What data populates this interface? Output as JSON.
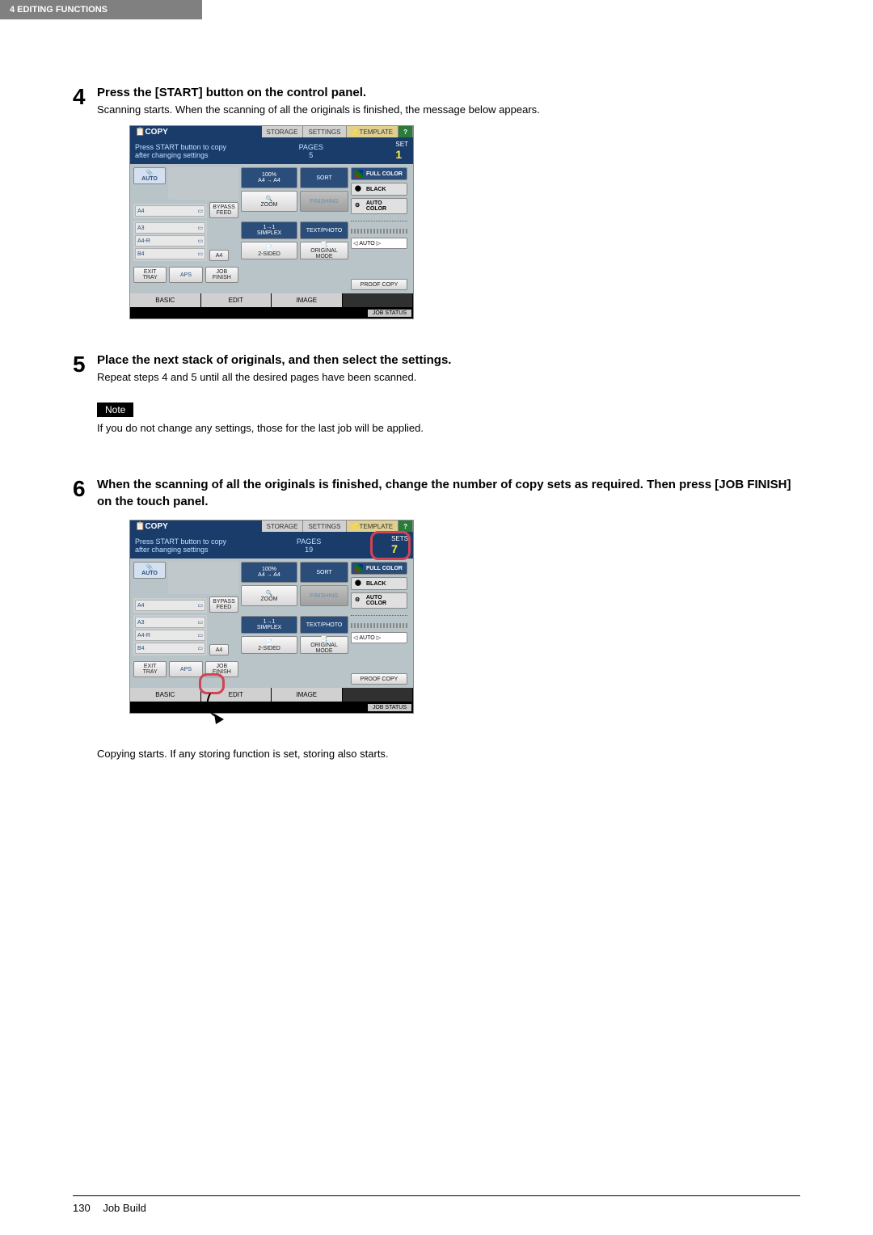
{
  "header": {
    "section": "4 EDITING FUNCTIONS"
  },
  "steps": [
    {
      "num": "4",
      "head": "Press the [START] button on the control panel.",
      "text": "Scanning starts. When the scanning of all the originals is finished, the message below appears."
    },
    {
      "num": "5",
      "head": "Place the next stack of originals, and then select the settings.",
      "text": "Repeat steps 4 and 5 until all the desired pages have been scanned.",
      "note_label": "Note",
      "note_text": "If you do not change any settings, those for the last job will be applied."
    },
    {
      "num": "6",
      "head": "When the scanning of all the originals is finished, change the number of copy sets as required. Then press [JOB FINISH] on the touch panel.",
      "after_text": "Copying starts. If any storing function is set, storing also starts."
    }
  ],
  "panel": {
    "copy": "COPY",
    "storage": "STORAGE",
    "settings": "SETTINGS",
    "template": "TEMPLATE",
    "help": "?",
    "msg_line1": "Press START button to copy",
    "msg_line2": "after changing settings",
    "pages_label": "PAGES",
    "set_label": "SET",
    "auto": "AUTO",
    "bypass": "BYPASS FEED",
    "a4": "A4",
    "a3": "A3",
    "a4r": "A4-R",
    "b4": "B4",
    "a4_small": "A4",
    "exit": "EXIT TRAY",
    "aps": "APS",
    "jobfinish": "JOB FINISH",
    "zoom_pct": "100%",
    "zoom_paper": "A4 → A4",
    "zoom": "ZOOM",
    "simplex_top": "1→1",
    "simplex": "SIMPLEX",
    "twosided": "2-SIDED",
    "sort": "SORT",
    "finishing": "FINISHING",
    "textphoto": "TEXT/PHOTO",
    "originalmode": "ORIGINAL MODE",
    "fullcolor": "FULL COLOR",
    "black": "BLACK",
    "autocolor": "AUTO COLOR",
    "autoadj": "AUTO",
    "proofcopy": "PROOF COPY",
    "tab_basic": "BASIC",
    "tab_edit": "EDIT",
    "tab_image": "IMAGE",
    "jobstatus": "JOB STATUS",
    "sets_label": "SETS"
  },
  "screenshot1": {
    "pages": "5",
    "sets": "1"
  },
  "screenshot2": {
    "pages": "19",
    "sets": "7"
  },
  "footer": {
    "pagenum": "130",
    "title": "Job Build"
  }
}
